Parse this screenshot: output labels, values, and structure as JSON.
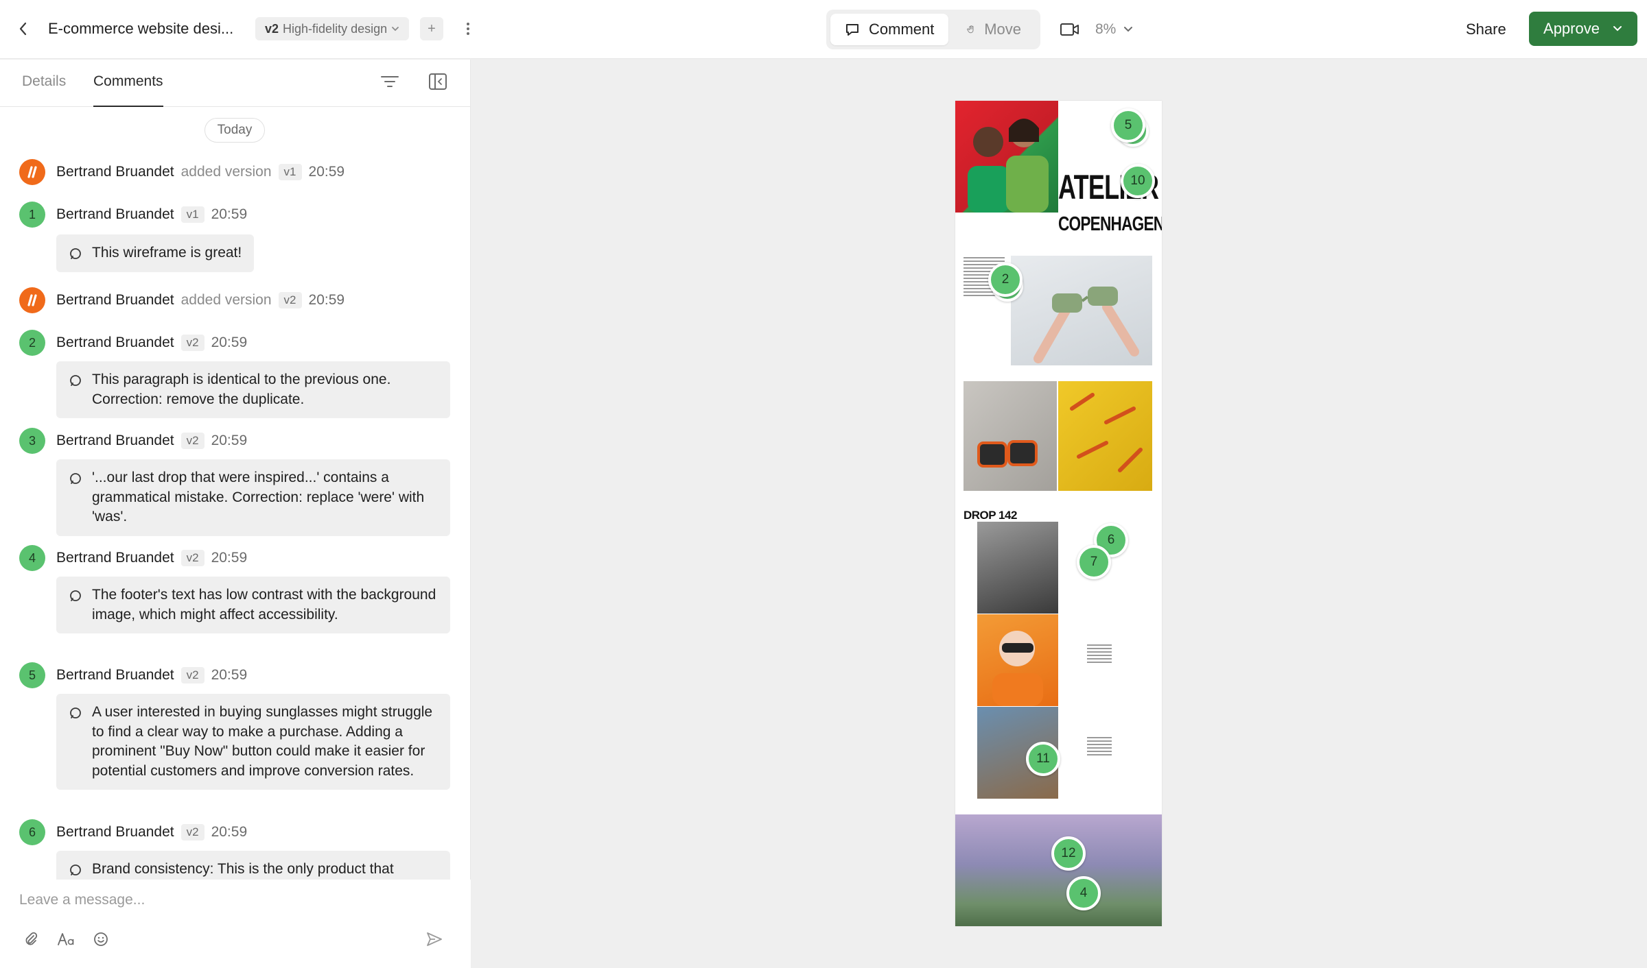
{
  "header": {
    "doc_title": "E-commerce website desi...",
    "version_tag": "v2",
    "version_name": "High-fidelity design",
    "plus_label": "+",
    "mode_comment": "Comment",
    "mode_move": "Move",
    "zoom": "8%",
    "share": "Share",
    "approve": "Approve"
  },
  "tabs": {
    "details": "Details",
    "comments": "Comments"
  },
  "feed": {
    "today": "Today",
    "events": [
      {
        "author": "Bertrand Bruandet",
        "action": "added version",
        "version": "v1",
        "time": "20:59"
      },
      {
        "author": "Bertrand Bruandet",
        "action": "added version",
        "version": "v2",
        "time": "20:59"
      }
    ],
    "comments": [
      {
        "number": "1",
        "author": "Bertrand Bruandet",
        "version": "v1",
        "time": "20:59",
        "text": "This wireframe is great!"
      },
      {
        "number": "2",
        "author": "Bertrand Bruandet",
        "version": "v2",
        "time": "20:59",
        "text": "This paragraph is identical to the previous one. Correction: remove the duplicate."
      },
      {
        "number": "3",
        "author": "Bertrand Bruandet",
        "version": "v2",
        "time": "20:59",
        "text": "'...our last drop that were inspired...' contains a grammatical mistake. Correction: replace 'were' with 'was'."
      },
      {
        "number": "4",
        "author": "Bertrand Bruandet",
        "version": "v2",
        "time": "20:59",
        "text": "The footer's text has low contrast with the background image, which might affect accessibility."
      },
      {
        "number": "5",
        "author": "Bertrand Bruandet",
        "version": "v2",
        "time": "20:59",
        "text": "A user interested in buying sunglasses might struggle to find a clear way to make a purchase. Adding a prominent \"Buy Now\" button could make it easier for potential customers and improve conversion rates."
      },
      {
        "number": "6",
        "author": "Bertrand Bruandet",
        "version": "v2",
        "time": "20:59",
        "text": "Brand consistency: This is the only product that"
      }
    ]
  },
  "composer": {
    "placeholder": "Leave a message..."
  },
  "canvas": {
    "brand_line1": "ATELIER",
    "brand_line2": "COPENHAGEN",
    "drop_title": "DROP 142",
    "pins": [
      "5",
      "10",
      "2",
      "6",
      "7",
      "11",
      "12",
      "4"
    ]
  },
  "colors": {
    "accent_green": "#2f7d3e",
    "pin_green": "#5ac26f",
    "logo_orange": "#f06a1a"
  }
}
